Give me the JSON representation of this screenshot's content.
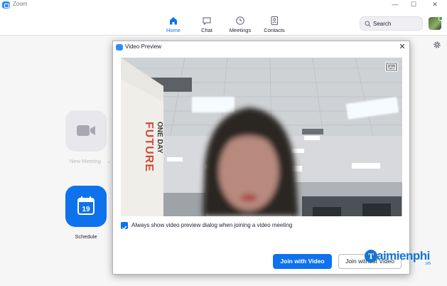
{
  "window": {
    "title": "Zoom",
    "controls": {
      "minimize": "—",
      "maximize": "☐",
      "close": "✕"
    }
  },
  "nav": {
    "items": [
      {
        "label": "Home",
        "icon": "home-icon",
        "active": true
      },
      {
        "label": "Chat",
        "icon": "chat-icon",
        "active": false
      },
      {
        "label": "Meetings",
        "icon": "clock-icon",
        "active": false
      },
      {
        "label": "Contacts",
        "icon": "contacts-icon",
        "active": false
      }
    ],
    "search_placeholder": "Search"
  },
  "home": {
    "new_meeting_label": "New Meeting",
    "new_meeting_chevron": "⌄",
    "schedule_label": "Schedule",
    "schedule_day": "19"
  },
  "dialog": {
    "title": "Video Preview",
    "close": "✕",
    "checkbox_label": "Always show video preview dialog when joining a video meeting",
    "checkbox_checked": true,
    "join_video_label": "Join with Video",
    "join_novideo_label": "Join without Video"
  },
  "watermark": {
    "letter": "T",
    "text": "aimienphi",
    "suffix": ".vn"
  },
  "colors": {
    "accent": "#0e72ed",
    "brand": "#2d8cff",
    "status_online": "#12b32a"
  }
}
